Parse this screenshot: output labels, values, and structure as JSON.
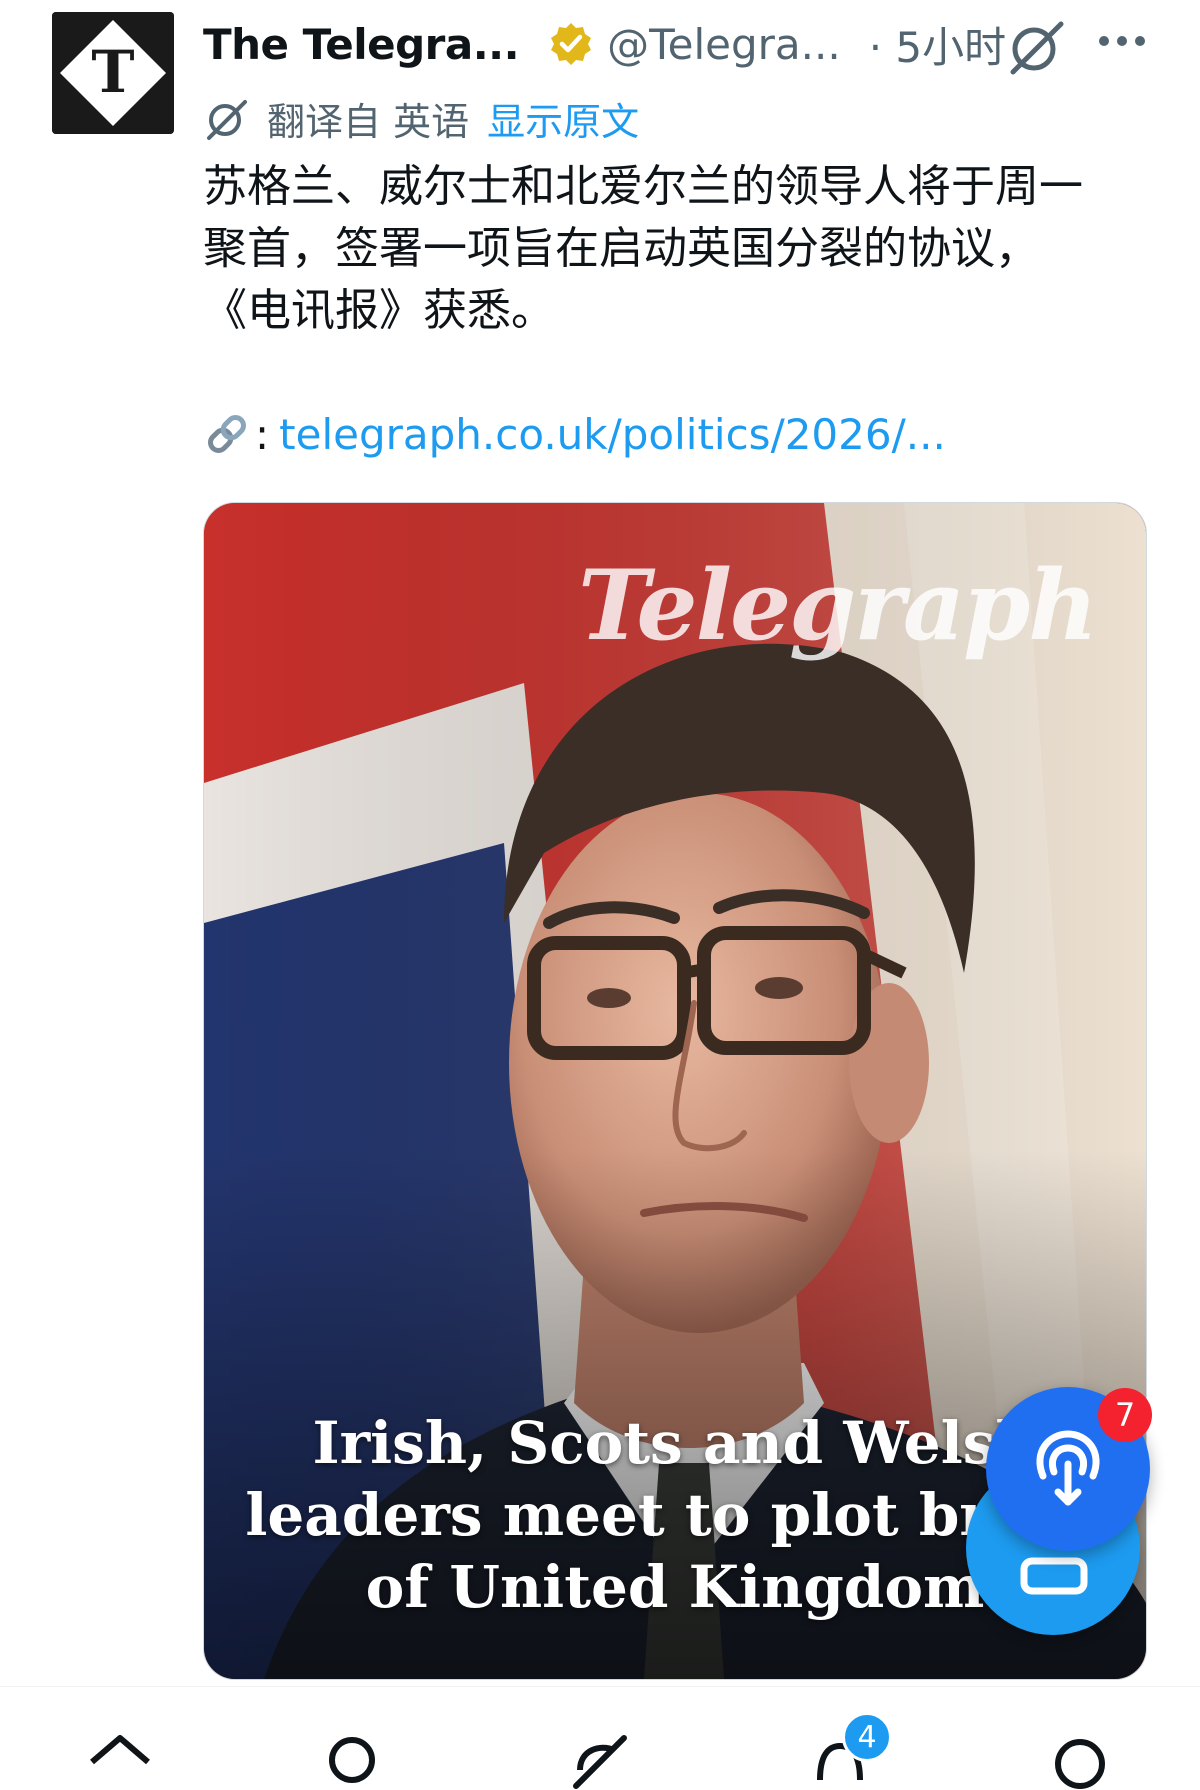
{
  "tweet": {
    "display_name": "The Telegra...",
    "handle": "@Telegra...",
    "time": "· 5小时",
    "translate_label": "翻译自 英语",
    "show_original": "显示原文",
    "text_lines": [
      "苏格兰、威尔士和北爱尔兰的领导人将于周一",
      "聚首，签署一项旨在启动英国分裂的协议，",
      "《电讯报》获悉。"
    ],
    "link_colon": ":",
    "link_url": "telegraph.co.uk/politics/2026/...",
    "media": {
      "masthead": "Telegraph",
      "headline_lines": [
        "Irish, Scots and Welsh",
        "leaders meet to plot break",
        "of United Kingdom"
      ]
    }
  },
  "avatar_letter": "T",
  "fab": {
    "badge": "7"
  },
  "nav": {
    "notifications_badge": "4",
    "items": [
      "home-icon",
      "search-icon",
      "grok-icon",
      "notifications-icon",
      "messages-icon"
    ]
  },
  "icons": {
    "verified": "verified-badge-icon",
    "grok": "grok-icon",
    "more": "more-icon",
    "link": "link-icon",
    "fab": "spaces-icon"
  },
  "colors": {
    "link_blue": "#1d9bf0",
    "verified_gold": "#e2b719",
    "secondary_text": "#536471",
    "fab_blue": "#1f6ff0",
    "badge_red": "#f4212e"
  }
}
